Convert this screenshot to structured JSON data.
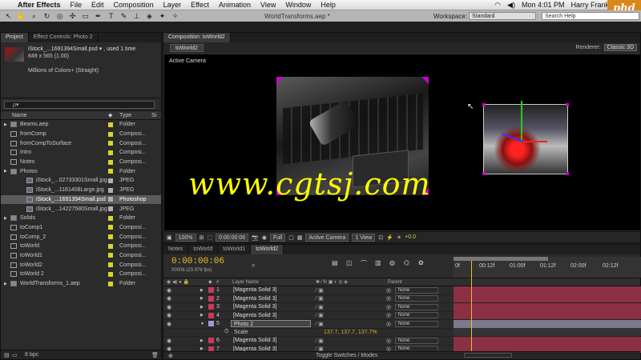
{
  "menubar": {
    "app": "After Effects",
    "items": [
      "File",
      "Edit",
      "Composition",
      "Layer",
      "Effect",
      "Animation",
      "View",
      "Window",
      "Help"
    ],
    "clock": "Mon 4:01 PM",
    "user": "Harry Frank",
    "logo": "phd"
  },
  "toolbar": {
    "window_title": "WorldTransforms.aep *",
    "workspace_label": "Workspace:",
    "workspace_value": "Standard",
    "search_placeholder": "Search Help"
  },
  "project": {
    "tabs": [
      "Project",
      "Effect Controls: Photo 2"
    ],
    "selected_name": "iStock_...1691394Small.psd ▾ , used 1 time",
    "selected_dims": "849 x 565 (1.00)",
    "selected_colors": "Millions of Colors+ (Straight)",
    "search_placeholder": "ρ▾",
    "columns": [
      "Name",
      "Type",
      "Si"
    ],
    "items": [
      {
        "name": "Beams.aep",
        "type": "Folder",
        "indent": 0,
        "kind": "folder",
        "color": "#d9d330"
      },
      {
        "name": "fromComp",
        "type": "Composi...",
        "indent": 0,
        "kind": "comp",
        "color": "#d9d330"
      },
      {
        "name": "fromCompToSurface",
        "type": "Composi...",
        "indent": 0,
        "kind": "comp",
        "color": "#d9d330"
      },
      {
        "name": "Intro",
        "type": "Composi...",
        "indent": 0,
        "kind": "comp",
        "color": "#d9d330"
      },
      {
        "name": "Notes",
        "type": "Composi...",
        "indent": 0,
        "kind": "comp",
        "color": "#d9d330"
      },
      {
        "name": "Photos",
        "type": "Folder",
        "indent": 0,
        "kind": "folder",
        "color": "#d9d330"
      },
      {
        "name": "iStock_...02733301Small.jpg",
        "type": "JPEG",
        "indent": 1,
        "kind": "img",
        "color": "#b0b0b0"
      },
      {
        "name": "iStock_...1161408Large.jpg",
        "type": "JPEG",
        "indent": 1,
        "kind": "img",
        "color": "#b0b0b0"
      },
      {
        "name": "iStock_...1691394Small.psd",
        "type": "Photoshop",
        "indent": 1,
        "kind": "img",
        "color": "#b0b0b0",
        "selected": true
      },
      {
        "name": "iStock_...14227580Small.jpg",
        "type": "JPEG",
        "indent": 1,
        "kind": "img",
        "color": "#b0b0b0"
      },
      {
        "name": "Solids",
        "type": "Folder",
        "indent": 0,
        "kind": "folder",
        "color": "#d9d330"
      },
      {
        "name": "toComp1",
        "type": "Composi...",
        "indent": 0,
        "kind": "comp",
        "color": "#d9d330"
      },
      {
        "name": "toComp_2",
        "type": "Composi...",
        "indent": 0,
        "kind": "comp",
        "color": "#d9d330"
      },
      {
        "name": "toWorld",
        "type": "Composi...",
        "indent": 0,
        "kind": "comp",
        "color": "#d9d330"
      },
      {
        "name": "toWorld1",
        "type": "Composi...",
        "indent": 0,
        "kind": "comp",
        "color": "#d9d330"
      },
      {
        "name": "toWorld2",
        "type": "Composi...",
        "indent": 0,
        "kind": "comp",
        "color": "#d9d330"
      },
      {
        "name": "toWorld 2",
        "type": "Composi...",
        "indent": 0,
        "kind": "comp",
        "color": "#d9d330"
      },
      {
        "name": "WorldTransforms_1.aep",
        "type": "Folder",
        "indent": 0,
        "kind": "folder",
        "color": "#d9d330"
      }
    ],
    "bpc": "8 bpc"
  },
  "composition": {
    "tab": "Composition: toWorld2",
    "crumb": "toWorld2",
    "renderer_label": "Renderer:",
    "renderer_value": "Classic 3D",
    "active_camera_label": "Active Camera",
    "watermark": "www.cgtsj.com",
    "footer": {
      "zoom": "100%",
      "timecode": "0:00:00:06",
      "resolution": "Full",
      "view": "Active Camera",
      "views": "1 View",
      "offset": "+0.0"
    }
  },
  "timeline": {
    "tabs": [
      "Notes",
      "toWorld",
      "toWorld1",
      "toWorld2"
    ],
    "current_time": "0:00:00:06",
    "fps": "00006 (23.976 fps)",
    "columns": [
      "Layer Name",
      "Parent"
    ],
    "ruler_ticks": [
      "0f",
      "00:12f",
      "01:00f",
      "01:12f",
      "02:00f",
      "02:12f"
    ],
    "layers": [
      {
        "num": "1",
        "name": "[Magenta Solid 3]",
        "parent": "None",
        "color": "#c83a55"
      },
      {
        "num": "2",
        "name": "[Magenta Solid 3]",
        "parent": "None",
        "color": "#c83a55"
      },
      {
        "num": "3",
        "name": "[Magenta Solid 3]",
        "parent": "None",
        "color": "#c83a55"
      },
      {
        "num": "4",
        "name": "[Magenta Solid 3]",
        "parent": "None",
        "color": "#c83a55"
      },
      {
        "num": "5",
        "name": "Photo 2",
        "parent": "None",
        "color": "#9b9bd8",
        "selected": true
      },
      {
        "num": "",
        "name": "Scale",
        "parent": "",
        "color": "",
        "sub": true,
        "value": "137.7, 137.7, 137.7%"
      },
      {
        "num": "6",
        "name": "[Magenta Solid 3]",
        "parent": "None",
        "color": "#c83a55"
      },
      {
        "num": "7",
        "name": "[Magenta Solid 3]",
        "parent": "None",
        "color": "#c83a55"
      }
    ],
    "toggle_label": "Toggle Switches / Modes"
  }
}
